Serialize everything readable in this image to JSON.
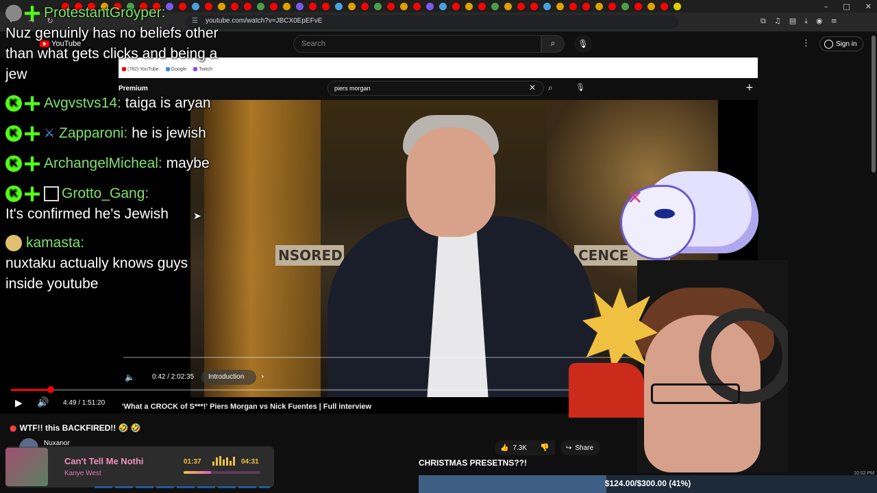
{
  "browser": {
    "url": "youtube.com/watch?v=JBCX0EpEFvE",
    "window_controls": [
      "–",
      "□",
      "✕"
    ]
  },
  "youtube": {
    "logo_text": "YouTube",
    "search_placeholder": "Search",
    "sign_in_label": "Sign in"
  },
  "inner_video_ui": {
    "premium_label": "Premium",
    "search_query": "piers morgan",
    "bookmarks": [
      "(782) YouTube",
      "Google",
      "Twitch"
    ],
    "time": "0:42 / 2:02:35",
    "chapter": "Introduction",
    "banner_left": "NSORED",
    "banner_right": "CENCE"
  },
  "player": {
    "time": "4:49 / 1:51:20",
    "progress": 0.043
  },
  "video": {
    "title": "'What a CROCK of S***!' Piers Morgan vs Nick Fuentes | Full interview",
    "channel": "Nuxanor",
    "likes": "7.3K",
    "share_label": "Share",
    "recommended_title": "WTF!! this BACKFIRED!! 🤣 🤣"
  },
  "chat": [
    {
      "user": "ProtestantGroyper:",
      "text": "Nuz genuinly has no beliefs other than what gets clicks and being a jew"
    },
    {
      "user": "Avgvstvs14:",
      "text": "taiga is aryan"
    },
    {
      "user": "Zapparoni:",
      "text": "he is jewish"
    },
    {
      "user": "ArchangelMicheal:",
      "text": "maybe"
    },
    {
      "user": "Grotto_Gang:",
      "text": "It's confirmed he's Jewish"
    },
    {
      "user": "kamasta:",
      "text": "nuxtaku actually knows guys inside youtube"
    }
  ],
  "now_playing": {
    "song": "Can't Tell Me Nothi",
    "artist": "Kanye West",
    "elapsed": "01:37",
    "duration": "04:31",
    "progress": 0.36
  },
  "goal": {
    "title": "CHRISTMAS PRESETNS??!",
    "text": "$124.00/$300.00 (41%)",
    "progress": 0.41
  },
  "system_clock": "10:02 PM",
  "colors": {
    "chat_username": "#7fe36b",
    "kick_green": "#53fc18",
    "yt_red": "#ff0000",
    "np_pink": "#f090c0",
    "np_gold": "#f0c040",
    "goal_fill": "#3d5f85"
  }
}
